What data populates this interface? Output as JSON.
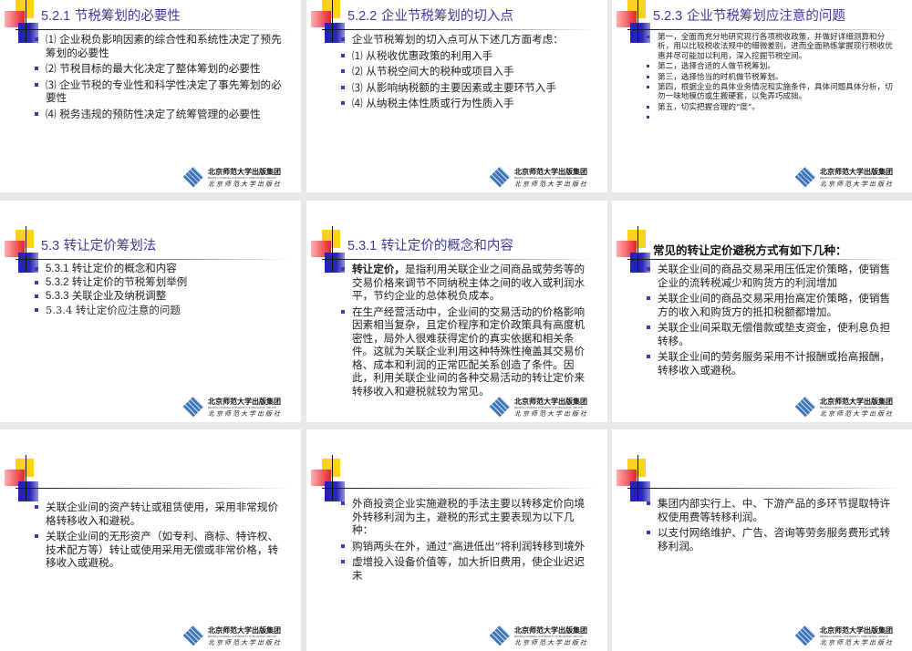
{
  "logo": {
    "name_cn": "北京师范大学出版集团",
    "name_en": "BEIJING NORMAL UNIVERSITY PUBLISHING GROUP",
    "press_cn": "北京师范大学出版社"
  },
  "slides": [
    {
      "title_num": "5.2.1",
      "title": "节税筹划的必要性",
      "bullets": [
        {
          "text": "⑴  企业税负影响因素的综合性和系统性决定了预先筹划的必要性"
        },
        {
          "text": "⑵ 节税目标的最大化决定了整体筹划的必要性"
        },
        {
          "text": "⑶ 企业节税的专业性和科学性决定了事先筹划的必要性"
        },
        {
          "text": "⑷  税务违规的预防性决定了统筹管理的必要性"
        }
      ]
    },
    {
      "title_num": "5.2.2",
      "title": "企业节税筹划的切入点",
      "bullets": [
        {
          "text": "企业节税筹划的切入点可从下述几方面考虑："
        },
        {
          "text": "⑴ 从税收优惠政策的利用入手"
        },
        {
          "text": "⑵ 从节税空间大的税种或项目入手"
        },
        {
          "text": "⑶ 从影响纳税额的主要因素或主要环节入手"
        },
        {
          "text": "⑷ 从纳税主体性质或行为性质入手"
        }
      ]
    },
    {
      "title_num": "5.2.3",
      "title": "企业节税筹划应注意的问题",
      "bullets": [
        {
          "text": "第一，全面而充分地研究现行各项税收政策，并做好详细测算和分析，用以比较税收法规中的细微差别，进而全面熟练掌握现行税收优惠并尽可能加以利用，深入挖掘节税空间。"
        },
        {
          "text": "第二，选择合适的人做节税筹划。"
        },
        {
          "text": "第三，选择恰当的时机做节税筹划。"
        },
        {
          "text": "第四，根据企业的具体业务情况和实施条件，具体问题具体分析，切勿一味地模仿或生搬硬套，以免弄巧成拙。"
        },
        {
          "text": "第五，切实把握合理的“度”。"
        },
        {
          "text": ""
        }
      ]
    },
    {
      "title_num": "5.3",
      "title": "转让定价筹划法",
      "bullets": [
        {
          "text": "5.3.1  转让定价的概念和内容"
        },
        {
          "text": "5.3.2  转让定价的节税筹划举例"
        },
        {
          "text": "5.3.3  关联企业及纳税调整"
        },
        {
          "text": "5.3.4  转让定价应注意的问题"
        }
      ]
    },
    {
      "title_num": "5.3.1",
      "title": "转让定价的概念和内容",
      "bullets": [
        {
          "bold": "转让定价，",
          "text": "是指利用关联企业之间商品或劳务等的交易价格来调节不同纳税主体之间的收入或利润水平，节约企业的总体税负成本。"
        },
        {
          "text": "在生产经营活动中，企业间的交易活动的价格影响因素相当复杂，且定价程序和定价政策具有高度机密性，局外人很难获得定价的真实依据和相关条件。这就为关联企业利用这种特殊性掩盖其交易价格、成本和利润的正常匹配关系创造了条件。因此，利用关联企业间的各种交易活动的转让定价来转移收入和避税就较为常见。"
        }
      ]
    },
    {
      "title_num": "",
      "title": "常见的转让定价避税方式有如下几种：",
      "bullets": [
        {
          "text": "关联企业间的商品交易采用压低定价策略，使销售企业的流转税减少和购货方的利润增加"
        },
        {
          "text": "关联企业间的商品交易采用抬高定价策略，使销售方的收入和购货方的抵扣税额都增加。"
        },
        {
          "text": "关联企业间采取无偿借款或垫支资金，使利息负担转移。"
        },
        {
          "text": "关联企业间的劳务服务采用不计报酬或抬高报酬，转移收入或避税。"
        }
      ]
    },
    {
      "title_num": "",
      "title": "",
      "bullets": [
        {
          "text": "关联企业间的资产转让或租赁使用，采用非常规价格转移收入和避税。"
        },
        {
          "text": "关联企业间的无形资产（如专利、商标、特许权、技术配方等）转让或使用采用无偿或非常价格，转移收入或避税。"
        }
      ]
    },
    {
      "title_num": "",
      "title": "",
      "bullets": [
        {
          "text": "外商投资企业实施避税的手法主要以转移定价向境外转移利润为主，避税的形式主要表现为以下几种："
        },
        {
          "text": "购销两头在外，通过“高进低出”将利润转移到境外"
        },
        {
          "text": "虚增投入设备价值等，加大折旧费用，使企业迟迟未"
        }
      ]
    },
    {
      "title_num": "",
      "title": "",
      "bullets": [
        {
          "text": "集团内部实行上、中、下游产品的多环节提取特许权使用费等转移利润。"
        },
        {
          "text": "以支付网络维护、广告、咨询等劳务服务费形式转移利润。"
        }
      ]
    }
  ]
}
